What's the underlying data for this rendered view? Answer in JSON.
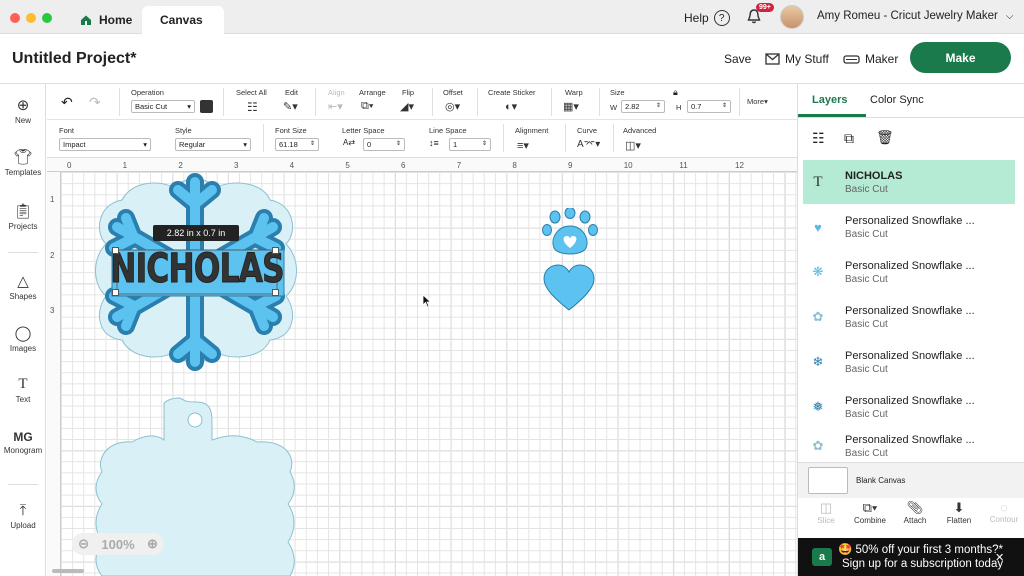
{
  "tabs": {
    "home": "Home",
    "canvas": "Canvas"
  },
  "topbar": {
    "help": "Help",
    "notif_badge": "99+",
    "user": "Amy Romeu - Cricut Jewelry Maker"
  },
  "header": {
    "title": "Untitled Project*",
    "save": "Save",
    "my_stuff": "My Stuff",
    "maker": "Maker",
    "make": "Make"
  },
  "leftrail": [
    {
      "label": "New",
      "icon": "plus-circle-icon"
    },
    {
      "label": "Templates",
      "icon": "shirt-icon"
    },
    {
      "label": "Projects",
      "icon": "clipboard-icon"
    },
    {
      "label": "Shapes",
      "icon": "shapes-icon"
    },
    {
      "label": "Images",
      "icon": "bulb-icon"
    },
    {
      "label": "Text",
      "icon": "text-icon"
    },
    {
      "label": "Monogram",
      "icon": "monogram-icon"
    },
    {
      "label": "Upload",
      "icon": "upload-icon"
    }
  ],
  "toolbar1": {
    "operation_label": "Operation",
    "operation_value": "Basic Cut",
    "select_all": "Select All",
    "edit": "Edit",
    "align": "Align",
    "arrange": "Arrange",
    "flip": "Flip",
    "offset": "Offset",
    "create_sticker": "Create Sticker",
    "warp": "Warp",
    "size": "Size",
    "w_label": "W",
    "w_value": "2.82",
    "h_label": "H",
    "h_value": "0.7",
    "more": "More"
  },
  "toolbar2": {
    "font_label": "Font",
    "font_value": "Impact",
    "style_label": "Style",
    "style_value": "Regular",
    "font_size_label": "Font Size",
    "font_size_value": "61.18",
    "letter_space_label": "Letter Space",
    "letter_space_value": "0",
    "line_space_label": "Line Space",
    "line_space_value": "1",
    "alignment_label": "Alignment",
    "curve_label": "Curve",
    "advanced_label": "Advanced"
  },
  "ruler": {
    "top": [
      "0",
      "1",
      "2",
      "3",
      "4",
      "5",
      "6",
      "7",
      "8",
      "9",
      "10",
      "11",
      "12"
    ],
    "left": [
      "1",
      "2",
      "3"
    ]
  },
  "canvas": {
    "size_tooltip": "2.82  in x 0.7  in",
    "text": "NICHOLAS",
    "zoom": "100%"
  },
  "panel": {
    "tab_layers": "Layers",
    "tab_color_sync": "Color Sync",
    "layers": [
      {
        "name": "NICHOLAS",
        "op": "Basic Cut",
        "icon": "text-icon"
      },
      {
        "name": "Personalized Snowflake ...",
        "op": "Basic Cut",
        "icon": "heart-icon"
      },
      {
        "name": "Personalized Snowflake ...",
        "op": "Basic Cut",
        "icon": "paw-icon"
      },
      {
        "name": "Personalized Snowflake ...",
        "op": "Basic Cut",
        "icon": "cloud-outline-icon"
      },
      {
        "name": "Personalized Snowflake ...",
        "op": "Basic Cut",
        "icon": "snowflake-icon"
      },
      {
        "name": "Personalized Snowflake ...",
        "op": "Basic Cut",
        "icon": "snowflake-icon"
      },
      {
        "name": "Personalized Snowflake ...",
        "op": "Basic Cut",
        "icon": "cloud-outline-icon"
      }
    ],
    "blank_canvas": "Blank Canvas",
    "tools": {
      "slice": "Slice",
      "combine": "Combine",
      "attach": "Attach",
      "flatten": "Flatten",
      "contour": "Contour"
    }
  },
  "promo": {
    "line1": "🤩 50% off your first 3 months?*",
    "line2": "Sign up for a subscription today"
  },
  "colors": {
    "accent": "#1a7a4c",
    "selected_layer": "#b5ead4",
    "shape_blue": "#5cc2ef",
    "shape_dark_blue": "#2a7fae",
    "shape_light": "#d9f1f6"
  }
}
